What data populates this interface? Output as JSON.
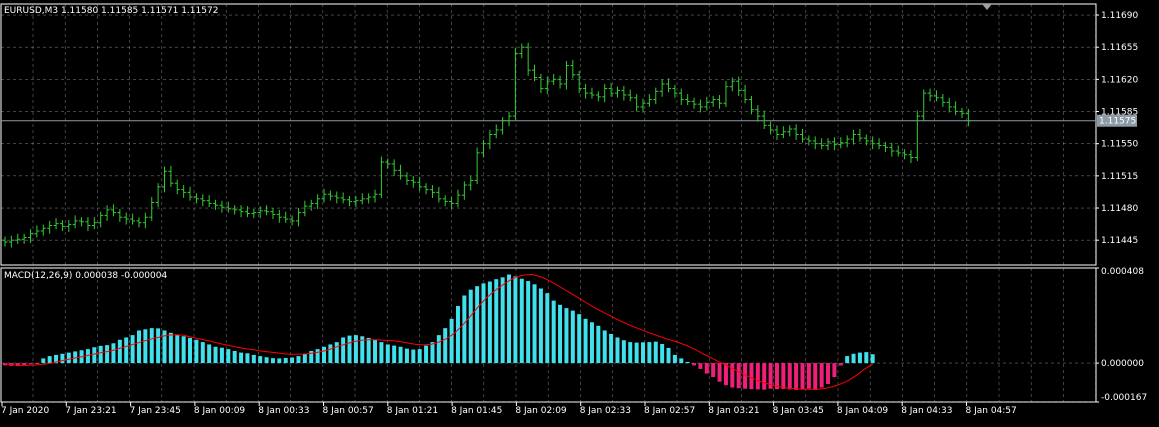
{
  "header": {
    "main_title": "EURUSD,M3  1.11580 1.11585 1.11571 1.11572",
    "macd_title": "MACD(12,26,9) 0.000038 -0.000004"
  },
  "current_price_label": "1.11575",
  "colors": {
    "background": "#000000",
    "grid": "#c8c8c8",
    "border": "#ffffff",
    "bar": "#33cc33",
    "hist_positive": "#40e0ec",
    "hist_negative": "#f0207a",
    "signal": "#ff0000",
    "text": "#ffffff",
    "price_line": "#8c9ba5",
    "price_tag_bg": "#8c9ba5"
  },
  "chart_data": [
    {
      "type": "bar",
      "name": "EURUSD,M3",
      "price_axis_labels": [
        "1.11690",
        "1.11655",
        "1.11620",
        "1.11585",
        "1.11550",
        "1.11515",
        "1.11480",
        "1.11445"
      ],
      "ylim": [
        1.11418,
        1.11702
      ],
      "current_price": 1.11575,
      "x_tick_labels": [
        "7 Jan 2020",
        "7 Jan 23:21",
        "7 Jan 23:45",
        "8 Jan 00:09",
        "8 Jan 00:33",
        "8 Jan 00:57",
        "8 Jan 01:21",
        "8 Jan 01:45",
        "8 Jan 02:09",
        "8 Jan 02:33",
        "8 Jan 02:57",
        "8 Jan 03:21",
        "8 Jan 03:45",
        "8 Jan 04:09",
        "8 Jan 04:33",
        "8 Jan 04:57"
      ],
      "close": [
        1.11443,
        1.11445,
        1.11446,
        1.11448,
        1.11452,
        1.11455,
        1.11458,
        1.11461,
        1.11463,
        1.1146,
        1.11462,
        1.11466,
        1.11465,
        1.11461,
        1.11464,
        1.11472,
        1.11478,
        1.11475,
        1.1147,
        1.11468,
        1.11466,
        1.11464,
        1.1147,
        1.11486,
        1.11503,
        1.1152,
        1.11507,
        1.115,
        1.11497,
        1.11492,
        1.1149,
        1.11488,
        1.11485,
        1.11483,
        1.11481,
        1.11479,
        1.11478,
        1.11476,
        1.11474,
        1.11475,
        1.11477,
        1.11476,
        1.11473,
        1.1147,
        1.11468,
        1.11466,
        1.11475,
        1.11482,
        1.11485,
        1.1149,
        1.11495,
        1.11493,
        1.11491,
        1.11489,
        1.11487,
        1.11488,
        1.1149,
        1.11492,
        1.11495,
        1.1153,
        1.11528,
        1.11521,
        1.11515,
        1.1151,
        1.11508,
        1.11503,
        1.115,
        1.11497,
        1.1149,
        1.11487,
        1.11485,
        1.11494,
        1.11505,
        1.1151,
        1.1154,
        1.1155,
        1.1156,
        1.11565,
        1.11575,
        1.1158,
        1.11648,
        1.11655,
        1.1163,
        1.11622,
        1.1161,
        1.11618,
        1.1162,
        1.11615,
        1.11635,
        1.11625,
        1.1161,
        1.11605,
        1.11603,
        1.11601,
        1.1161,
        1.11605,
        1.11608,
        1.11603,
        1.116,
        1.1159,
        1.11594,
        1.11598,
        1.11607,
        1.11615,
        1.1161,
        1.11605,
        1.11598,
        1.11596,
        1.11593,
        1.1159,
        1.11595,
        1.11598,
        1.11594,
        1.11612,
        1.11618,
        1.11608,
        1.11598,
        1.11587,
        1.1158,
        1.1157,
        1.11565,
        1.1156,
        1.11563,
        1.11566,
        1.1156,
        1.11555,
        1.11553,
        1.1155,
        1.11548,
        1.11552,
        1.11549,
        1.11551,
        1.11555,
        1.1156,
        1.11556,
        1.11553,
        1.1155,
        1.11548,
        1.11546,
        1.11542,
        1.1154,
        1.11538,
        1.11535,
        1.1158,
        1.11605,
        1.11602,
        1.116,
        1.11595,
        1.1159,
        1.11585,
        1.11583,
        1.11575
      ]
    },
    {
      "type": "bar",
      "name": "MACD(12,26,9)",
      "price_axis_labels": [
        "0.000408",
        "0.000000",
        "-0.000167"
      ],
      "ylim": [
        -0.000167,
        0.000408
      ],
      "histogram": [
        -1e-05,
        -1.2e-05,
        -1.3e-05,
        -1e-05,
        -5e-06,
        -2e-06,
        2e-05,
        3e-05,
        3.5e-05,
        4e-05,
        4.5e-05,
        5e-05,
        5.5e-05,
        6e-05,
        6.8e-05,
        7.4e-05,
        7.7e-05,
        8.5e-05,
        0.0001,
        0.00011,
        0.00012,
        0.00014,
        0.000145,
        0.00015,
        0.000149,
        0.00014,
        0.00013,
        0.00012,
        0.000115,
        0.000108,
        0.0001,
        9e-05,
        8e-05,
        7e-05,
        6.6e-05,
        6e-05,
        5.2e-05,
        4.5e-05,
        4.2e-05,
        3.5e-05,
        3e-05,
        2.5e-05,
        2.1e-05,
        2e-05,
        2.2e-05,
        2.4e-05,
        3e-05,
        4e-05,
        5.2e-05,
        6e-05,
        7e-05,
        8e-05,
        9e-05,
        0.00011,
        0.000118,
        0.00012,
        0.000115,
        0.000108,
        0.0001,
        9e-05,
        8e-05,
        7.5e-05,
        7e-05,
        6.2e-05,
        5.8e-05,
        6e-05,
        7.5e-05,
        9e-05,
        0.00012,
        0.00015,
        0.00019,
        0.000245,
        0.00029,
        0.000315,
        0.00033,
        0.000342,
        0.00035,
        0.00036,
        0.000368,
        0.00038,
        0.000372,
        0.000362,
        0.000352,
        0.000338,
        0.00032,
        0.0003,
        0.000268,
        0.00025,
        0.000236,
        0.000225,
        0.00021,
        0.00019,
        0.000175,
        0.00016,
        0.00014,
        0.000125,
        0.00011,
        9.8e-05,
        9e-05,
        8.8e-05,
        8.9e-05,
        9e-05,
        9.2e-05,
        8.2e-05,
        6.5e-05,
        3.5e-05,
        2e-05,
        5e-06,
        -1e-05,
        -2.5e-05,
        -4.5e-05,
        -6e-05,
        -8e-05,
        -9.5e-05,
        -0.000105,
        -0.000108,
        -0.00011,
        -0.000112,
        -0.000113,
        -0.000114,
        -0.00011,
        -0.000112,
        -0.000111,
        -0.000113,
        -0.000115,
        -0.000112,
        -0.00011,
        -0.000115,
        -0.000105,
        -9e-05,
        -6e-05,
        -1e-05,
        3e-05,
        4e-05,
        4.5e-05,
        4.7e-05,
        3.8e-05
      ],
      "signal": [
        -5e-06,
        -8e-06,
        -1e-05,
        -1e-05,
        -8e-06,
        -5e-06,
        0.0,
        8e-06,
        1.5e-05,
        2.2e-05,
        2.8e-05,
        3.5e-05,
        4.2e-05,
        4.8e-05,
        5.5e-05,
        6.5e-05,
        7.5e-05,
        8.5e-05,
        9.5e-05,
        0.000104,
        0.000112,
        0.00012,
        0.000122,
        0.00012,
        0.000112,
        0.000104,
        9.8e-05,
        9e-05,
        8.2e-05,
        7.5e-05,
        6.8e-05,
        6.2e-05,
        5.8e-05,
        5.2e-05,
        4.8e-05,
        4.4e-05,
        4e-05,
        3.8e-05,
        3.8e-05,
        4e-05,
        4.4e-05,
        5e-05,
        6e-05,
        7.2e-05,
        8.2e-05,
        9.2e-05,
        9.8e-05,
        0.0001,
        0.0001,
        9.8e-05,
        9.6e-05,
        9.2e-05,
        8.6e-05,
        8e-05,
        7.8e-05,
        8e-05,
        9e-05,
        0.000105,
        0.000128,
        0.00016,
        0.000198,
        0.000238,
        0.000275,
        0.000305,
        0.00033,
        0.000352,
        0.00037,
        0.000378,
        0.00038,
        0.000372,
        0.000358,
        0.00034,
        0.00032,
        0.0003,
        0.00028,
        0.00026,
        0.00024,
        0.000222,
        0.000205,
        0.000188,
        0.000172,
        0.000158,
        0.000145,
        0.000132,
        0.00012,
        0.000108,
        9.8e-05,
        8.8e-05,
        7.5e-05,
        6e-05,
        4.2e-05,
        2.5e-05,
        8e-06,
        -8e-06,
        -2.5e-05,
        -4.2e-05,
        -5.8e-05,
        -7.2e-05,
        -8.5e-05,
        -9.5e-05,
        -0.000102,
        -0.000107,
        -0.00011,
        -0.000112,
        -0.000113,
        -0.000112,
        -0.000108,
        -0.0001,
        -8.8e-05,
        -7.2e-05,
        -5e-05,
        -2.5e-05,
        -4e-06
      ]
    }
  ]
}
